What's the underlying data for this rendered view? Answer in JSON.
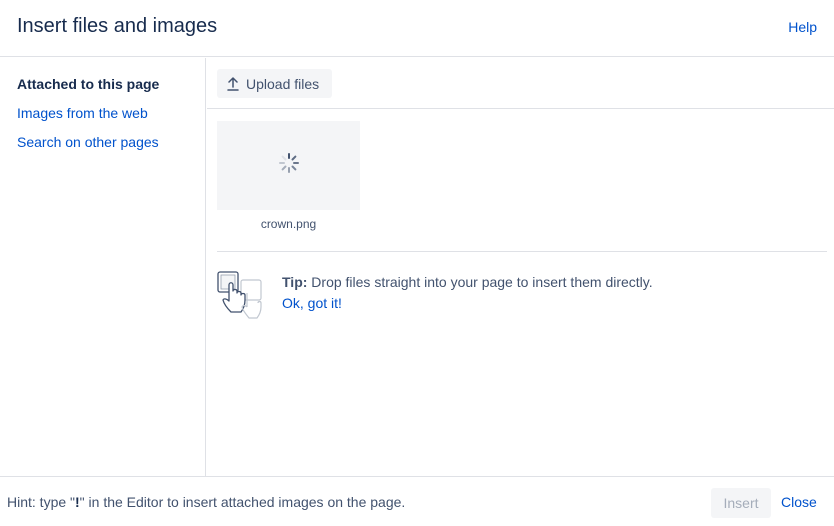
{
  "dialog": {
    "title": "Insert files and images",
    "help_label": "Help"
  },
  "sidebar": {
    "items": [
      {
        "label": "Attached to this page",
        "active": true
      },
      {
        "label": "Images from the web",
        "active": false
      },
      {
        "label": "Search on other pages",
        "active": false
      }
    ]
  },
  "toolbar": {
    "upload_label": "Upload files",
    "upload_icon": "upload-arrow-icon"
  },
  "files": [
    {
      "name": "crown.png",
      "status": "loading",
      "status_icon": "loading-spinner-icon"
    }
  ],
  "tip": {
    "label": "Tip:",
    "text": " Drop files straight into your page to insert them directly.",
    "dismiss_label": "Ok, got it!",
    "icon": "drag-drop-hand-icon"
  },
  "footer": {
    "hint_prefix": "Hint: type \"",
    "hint_key": "!",
    "hint_suffix": "\" in the Editor to insert attached images on the page.",
    "insert_label": "Insert",
    "insert_disabled": true,
    "close_label": "Close"
  },
  "colors": {
    "link": "#0052cc",
    "text_primary": "#172b4d",
    "text_secondary": "#42526e",
    "border": "#dfe1e6",
    "button_bg": "#f4f5f7",
    "disabled_text": "#a5adba"
  }
}
